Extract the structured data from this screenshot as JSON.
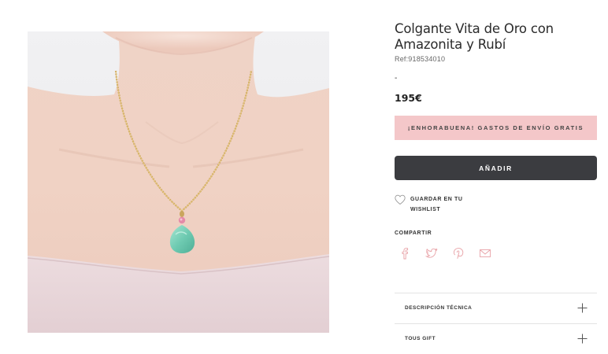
{
  "product": {
    "title": "Colgante Vita de Oro con Amazonita y Rubí",
    "ref": "Ref:918534010",
    "dash": "-",
    "price": "195€",
    "image_icon": "necklace-model-photo"
  },
  "shipping_banner": "¡ENHORABUENA! GASTOS DE ENVÍO GRATIS",
  "add_button": "AÑADIR",
  "wishlist": {
    "label": "GUARDAR EN TU WISHLIST",
    "icon": "heart-icon"
  },
  "share": {
    "title": "COMPARTIR",
    "icons": [
      "facebook-icon",
      "twitter-icon",
      "pinterest-icon",
      "email-icon"
    ]
  },
  "accordion": [
    {
      "label": "DESCRIPCIÓN TÉCNICA",
      "icon": "plus-icon"
    },
    {
      "label": "TOUS GIFT",
      "icon": "plus-icon"
    }
  ],
  "colors": {
    "banner_bg": "#f4c7c9",
    "button_bg": "#3b3c40",
    "share_icon": "#e8a2a7"
  }
}
